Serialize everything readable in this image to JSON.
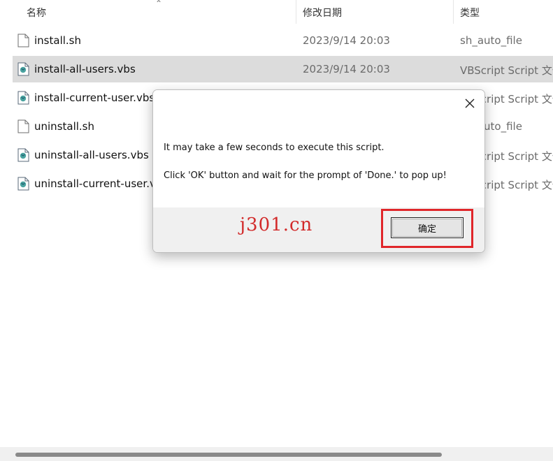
{
  "header": {
    "col_name": "名称",
    "col_date": "修改日期",
    "col_type": "类型"
  },
  "files": [
    {
      "name": "install.sh",
      "date": "2023/9/14 20:03",
      "type": "sh_auto_file",
      "icon": "blank-file-icon"
    },
    {
      "name": "install-all-users.vbs",
      "date": "2023/9/14 20:03",
      "type": "VBScript Script 文件",
      "icon": "vbs-script-icon"
    },
    {
      "name": "install-current-user.vbs",
      "date": "",
      "type": "VBScript Script 文件",
      "icon": "vbs-script-icon"
    },
    {
      "name": "uninstall.sh",
      "date": "",
      "type": "sh_auto_file",
      "icon": "blank-file-icon"
    },
    {
      "name": "uninstall-all-users.vbs",
      "date": "",
      "type": "VBScript Script 文件",
      "icon": "vbs-script-icon"
    },
    {
      "name": "uninstall-current-user.vbs",
      "date": "",
      "type": "VBScript Script 文件",
      "icon": "vbs-script-icon"
    }
  ],
  "dialog": {
    "message_line1": "It may take a few seconds to execute this script.",
    "message_line2": "Click 'OK' button and wait for the prompt of 'Done.' to pop up!",
    "ok_label": "确定",
    "close_icon": "close-icon"
  },
  "watermark": "j301.cn",
  "colors": {
    "selected_row": "#dcdcdc",
    "highlight_border": "#e0262a",
    "watermark": "#d22a2a"
  }
}
